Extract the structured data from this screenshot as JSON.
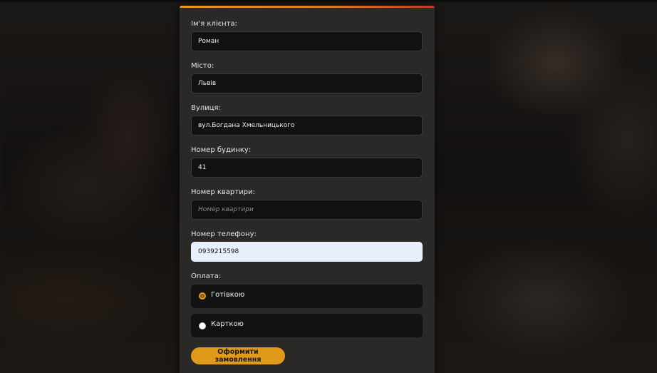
{
  "form": {
    "client_name": {
      "label": "Ім'я клієнта:",
      "value": "Роман",
      "placeholder": ""
    },
    "city": {
      "label": "Місто:",
      "value": "Львів",
      "placeholder": ""
    },
    "street": {
      "label": "Вулиця:",
      "value": "вул.Богдана Хмельницького",
      "placeholder": ""
    },
    "house": {
      "label": "Номер будинку:",
      "value": "41",
      "placeholder": ""
    },
    "apartment": {
      "label": "Номер квартири:",
      "value": "",
      "placeholder": "Номер квартири"
    },
    "phone": {
      "label": "Номер телефону:",
      "value": "0939215598",
      "placeholder": ""
    },
    "payment": {
      "label": "Оплата:",
      "options": [
        {
          "label": "Готівкою",
          "selected": true
        },
        {
          "label": "Карткою",
          "selected": false
        }
      ]
    },
    "submit_label": "Оформити замовлення"
  },
  "colors": {
    "accent": "#e39a1e",
    "card_background": "#2a2927",
    "field_background": "#111111",
    "autofill_background": "#e8f0fe"
  }
}
